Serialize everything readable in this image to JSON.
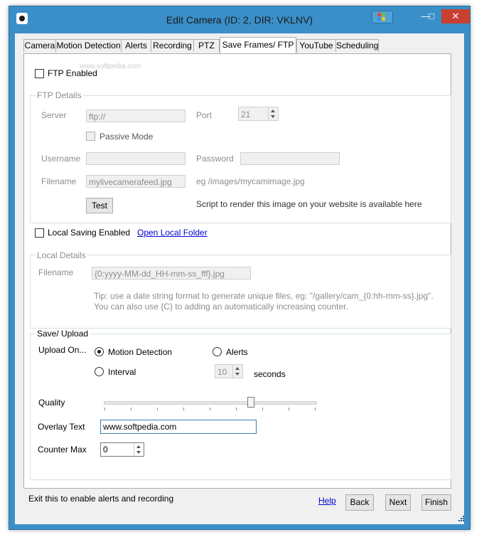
{
  "window": {
    "title": "Edit Camera (ID: 2, DIR: VKLNV)",
    "minimize": "—",
    "maximize": "□",
    "close": "✕"
  },
  "watermark": "www.softpedia.com",
  "tabs": [
    "Camera",
    "Motion Detection",
    "Alerts",
    "Recording",
    "PTZ",
    "Save Frames/ FTP",
    "YouTube",
    "Scheduling"
  ],
  "active_tab": "Save Frames/ FTP",
  "ftp": {
    "enabled_label": "FTP Enabled",
    "enabled": false,
    "group_title": "FTP Details",
    "server_label": "Server",
    "server_value": "ftp://",
    "port_label": "Port",
    "port_value": "21",
    "passive_label": "Passive Mode",
    "username_label": "Username",
    "username_value": "",
    "password_label": "Password",
    "password_value": "",
    "filename_label": "Filename",
    "filename_value": "mylivecamerafeed.jpg",
    "filename_hint": "eg /images/mycamimage.jpg",
    "test_button": "Test",
    "script_text": "Script to render this image on your website is available here"
  },
  "local": {
    "enabled_label": "Local Saving Enabled",
    "open_folder_link": "Open Local Folder",
    "group_title": "Local Details",
    "filename_label": "Filename",
    "filename_value": "{0:yyyy-MM-dd_HH-mm-ss_fff}.jpg",
    "tip_line1": "Tip: use a date string format to generate unique files, eg: \"/gallery/cam_{0:hh-mm-ss}.jpg\".",
    "tip_line2": "You can also use {C} to adding an automatically increasing counter."
  },
  "save_upload": {
    "group_title": "Save/ Upload",
    "upload_on_label": "Upload On...",
    "options": [
      "Motion Detection",
      "Alerts",
      "Interval"
    ],
    "selected": "Motion Detection",
    "interval_value": "10",
    "seconds_label": "seconds",
    "quality_label": "Quality",
    "quality_fraction": 0.69,
    "overlay_label": "Overlay Text",
    "overlay_value": "www.softpedia.com",
    "counter_label": "Counter Max",
    "counter_value": "0"
  },
  "footer": {
    "hint": "Exit this to enable alerts and recording",
    "help": "Help",
    "back": "Back",
    "next": "Next",
    "finish": "Finish"
  },
  "colors": {
    "titlebar": "#3a8fc8",
    "close": "#c84031",
    "link": "#0000cc"
  }
}
